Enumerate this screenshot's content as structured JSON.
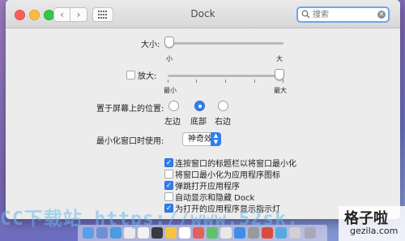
{
  "window": {
    "title": "Dock",
    "search_placeholder": "搜索"
  },
  "size": {
    "label": "大小:",
    "min_label": "小",
    "max_label": "大",
    "value_fraction": 0.0
  },
  "magnification": {
    "checkbox_label": "放大:",
    "checked": false,
    "min_label": "最小",
    "max_label": "最大",
    "value_fraction": 1.0
  },
  "position": {
    "label": "置于屏幕上的位置:",
    "options": [
      "左边",
      "底部",
      "右边"
    ],
    "selected": "底部"
  },
  "minimize": {
    "label": "最小化窗口时使用:",
    "effect": "神奇效果"
  },
  "options": [
    {
      "label": "连按窗口的标题栏以将窗口最小化",
      "checked": true
    },
    {
      "label": "将窗口最小化为应用程序图标",
      "checked": false
    },
    {
      "label": "弹跳打开应用程序",
      "checked": true
    },
    {
      "label": "自动显示和隐藏 Dock",
      "checked": false
    },
    {
      "label": "为打开的应用程序显示指示灯",
      "checked": true
    }
  ],
  "watermark": {
    "left_text": "CC下载站 https://www.52sk.",
    "brand_cn": "格子啦",
    "brand_url": "gezila.com"
  },
  "colors": {
    "accent": "#2f7fee",
    "background": "#ececec"
  }
}
